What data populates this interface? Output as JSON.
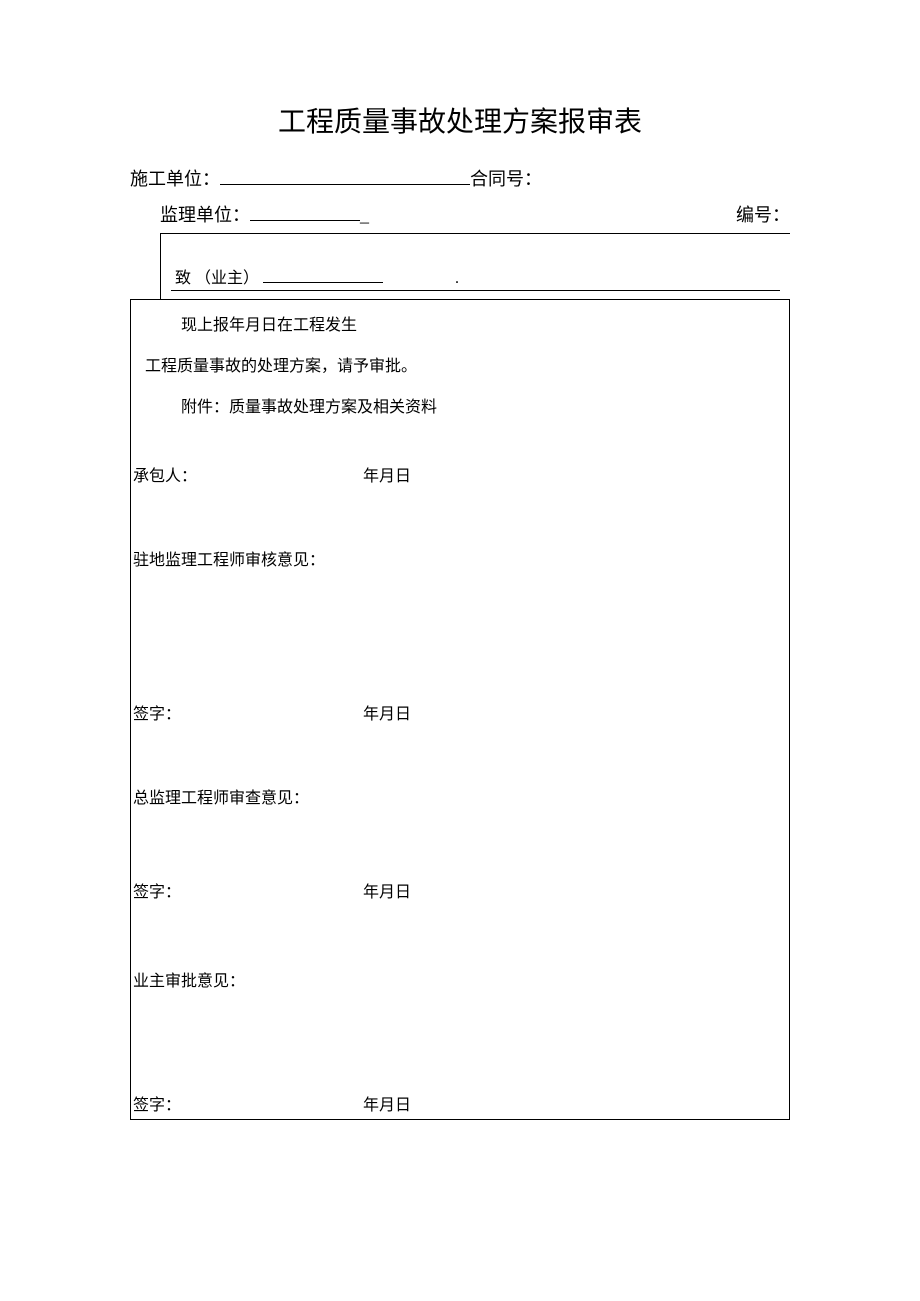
{
  "title": "工程质量事故处理方案报审表",
  "header": {
    "construction_unit_label": "施工单位：",
    "contract_no_label": "合同号：",
    "supervision_unit_label": "监理单位：",
    "underscore": "_",
    "serial_no_label": "编号："
  },
  "to_owner": {
    "label": "致 （业主）",
    "dot": "."
  },
  "report": {
    "line1": "现上报年月日在工程发生",
    "line2": "工程质量事故的处理方案，请予审批。",
    "attachment": "附件：质量事故处理方案及相关资料"
  },
  "contractor": {
    "label": "承包人：",
    "date": "年月日"
  },
  "resident_engineer": {
    "label": "驻地监理工程师审核意见：",
    "sign_label": "签字：",
    "date": "年月日"
  },
  "chief_engineer": {
    "label": "总监理工程师审查意见：",
    "sign_label": "签字：",
    "date": "年月日"
  },
  "owner_approval": {
    "label": "业主审批意见：",
    "sign_label": "签字：",
    "date": "年月日"
  }
}
